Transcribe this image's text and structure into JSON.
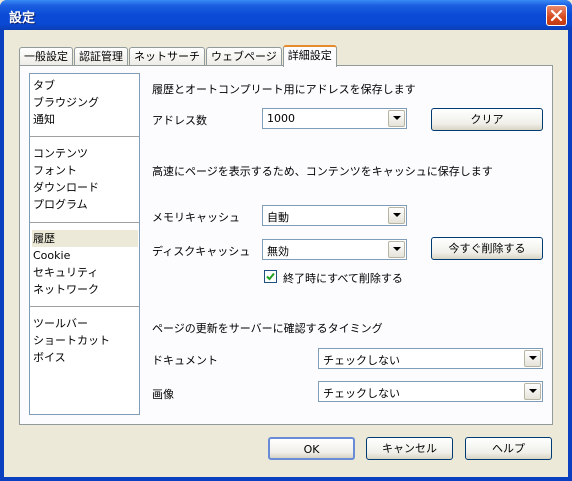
{
  "window": {
    "title": "設定"
  },
  "tabs": [
    "一般設定",
    "認証管理",
    "ネットサーチ",
    "ウェブページ",
    "詳細設定"
  ],
  "sidebar": {
    "groups": [
      [
        "タブ",
        "ブラウジング",
        "通知"
      ],
      [
        "コンテンツ",
        "フォント",
        "ダウンロード",
        "プログラム"
      ],
      [
        "履歴",
        "Cookie",
        "セキュリティ",
        "ネットワーク"
      ],
      [
        "ツールバー",
        "ショートカット",
        "ボイス"
      ]
    ],
    "selected": "履歴"
  },
  "history": {
    "section_label": "履歴とオートコンプリート用にアドレスを保存します",
    "address_count_label": "アドレス数",
    "address_count_value": "1000",
    "clear_button": "クリア"
  },
  "cache": {
    "section_label": "高速にページを表示するため、コンテンツをキャッシュに保存します",
    "memory_label": "メモリキャッシュ",
    "memory_value": "自動",
    "disk_label": "ディスクキャッシュ",
    "disk_value": "無効",
    "delete_now_button": "今すぐ削除する",
    "clear_on_exit_label": "終了時にすべて削除する",
    "clear_on_exit_checked": true
  },
  "check_timing": {
    "section_label": "ページの更新をサーバーに確認するタイミング",
    "document_label": "ドキュメント",
    "document_value": "チェックしない",
    "image_label": "画像",
    "image_value": "チェックしない"
  },
  "footer": {
    "ok": "OK",
    "cancel": "キャンセル",
    "help": "ヘルプ"
  }
}
